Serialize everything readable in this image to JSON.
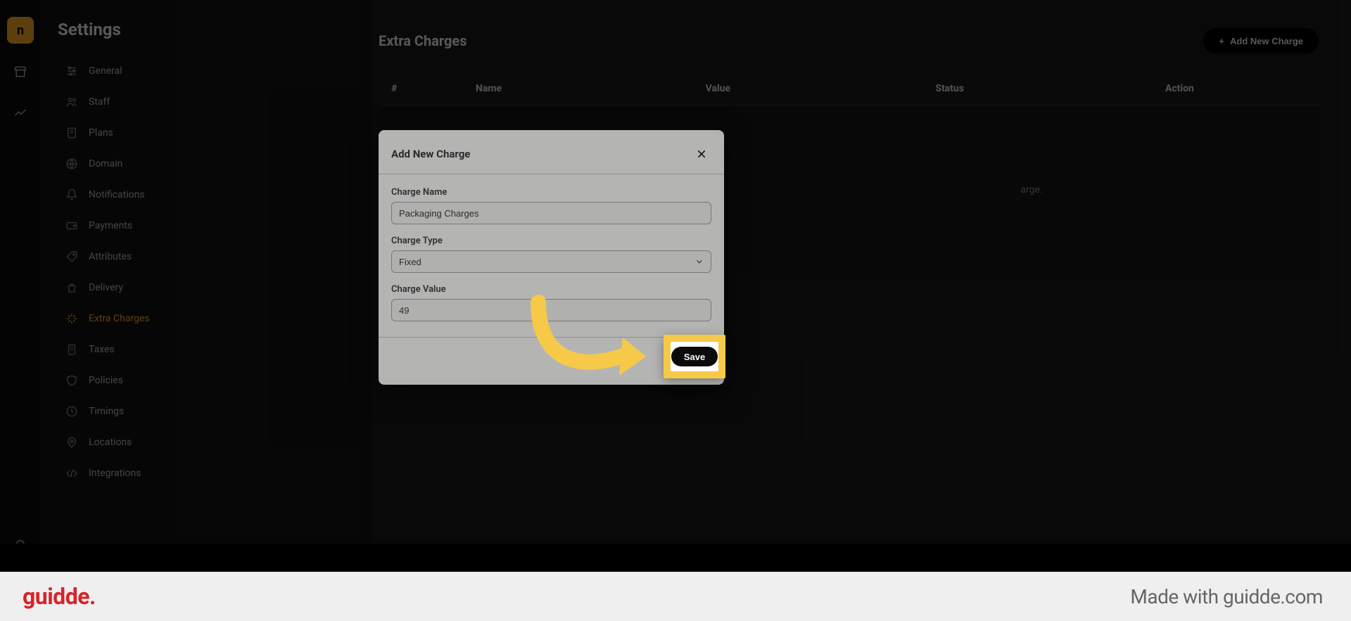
{
  "rail": {
    "logo_text": "n"
  },
  "sidebar": {
    "title": "Settings",
    "items": [
      {
        "label": "General"
      },
      {
        "label": "Staff"
      },
      {
        "label": "Plans"
      },
      {
        "label": "Domain"
      },
      {
        "label": "Notifications"
      },
      {
        "label": "Payments"
      },
      {
        "label": "Attributes"
      },
      {
        "label": "Delivery"
      },
      {
        "label": "Extra Charges"
      },
      {
        "label": "Taxes"
      },
      {
        "label": "Policies"
      },
      {
        "label": "Timings"
      },
      {
        "label": "Locations"
      },
      {
        "label": "Integrations"
      }
    ]
  },
  "main": {
    "title": "Extra Charges",
    "add_button": "Add New Charge",
    "columns": {
      "num": "#",
      "name": "Name",
      "value": "Value",
      "status": "Status",
      "action": "Action"
    },
    "empty_suffix": "arge."
  },
  "modal": {
    "title": "Add New Charge",
    "fields": {
      "name_label": "Charge Name",
      "name_value": "Packaging Charges",
      "type_label": "Charge Type",
      "type_value": "Fixed",
      "value_label": "Charge Value",
      "value_value": "49"
    },
    "close_label": "Close",
    "save_label": "Save"
  },
  "brand": {
    "logo": "guidde.",
    "tag": "Made with guidde.com"
  }
}
